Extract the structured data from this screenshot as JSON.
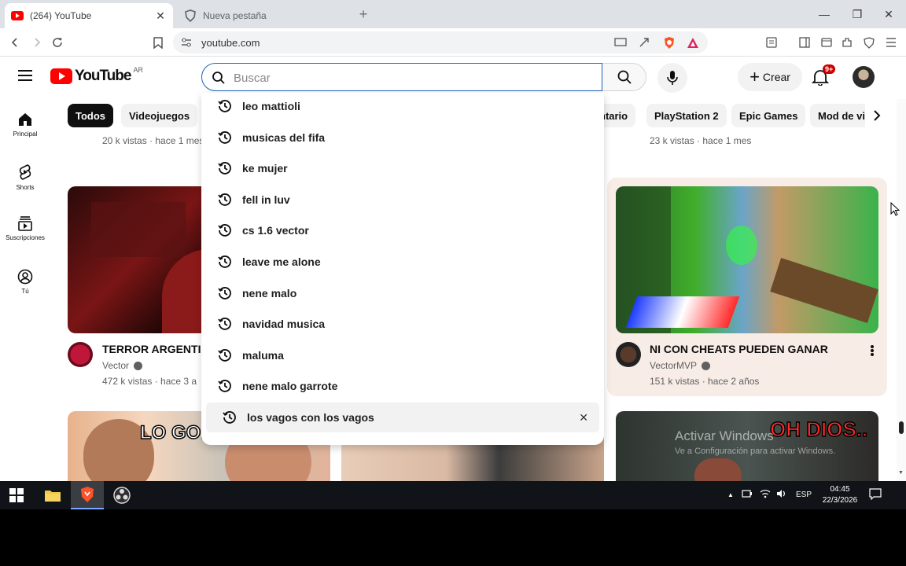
{
  "browser": {
    "tabs": [
      {
        "title": "(264) YouTube",
        "close": "✕"
      },
      {
        "title": "Nueva pestaña"
      }
    ],
    "new_tab": "+",
    "url": "youtube.com",
    "window": {
      "minimize": "—",
      "restore": "❐",
      "close": "✕"
    }
  },
  "youtube": {
    "logo_text": "YouTube",
    "country": "AR",
    "search_placeholder": "Buscar",
    "create_label": "Crear",
    "notification_badge": "9+",
    "sidebar": [
      {
        "label": "Principal",
        "icon": "home-icon"
      },
      {
        "label": "Shorts",
        "icon": "shorts-icon"
      },
      {
        "label": "Suscripciones",
        "icon": "subscriptions-icon"
      },
      {
        "label": "Tú",
        "icon": "you-icon"
      }
    ],
    "chips": [
      "Todos",
      "Videojuegos",
      "ntario",
      "PlayStation 2",
      "Epic Games",
      "Mod de vid"
    ],
    "top_row_meta": [
      "20 k vistas · hace 1 mes",
      "23 k vistas · hace 1 mes"
    ],
    "videos": [
      {
        "title": "TERROR ARGENTIN",
        "channel": "Vector",
        "stats": "472 k vistas · hace 3 a"
      },
      {
        "title": "NI CON CHEATS PUEDEN GANAR",
        "channel": "VectorMVP",
        "stats": "151 k vistas · hace 2 años"
      }
    ],
    "thumb_texts": {
      "lo_gol": "LO GOL",
      "oh_dios": "OH DIOS..",
      "activar_title": "Activar Windows",
      "activar_sub": "Ve a Configuración para activar Windows."
    }
  },
  "suggestions": [
    "leo mattioli",
    "musicas del fifa",
    "ke mujer",
    "fell in luv",
    "cs 1.6 vector",
    "leave me alone",
    "nene malo",
    "navidad musica",
    "maluma",
    "nene malo garrote",
    "los vagos con los vagos"
  ],
  "suggestion_remove": "✕",
  "taskbar": {
    "lang": "ESP",
    "time": "04:45",
    "date": "22/3/2026"
  },
  "colors": {
    "youtube_red": "#ff0000",
    "search_focus": "#1c62b9",
    "taskbar": "#101317"
  }
}
